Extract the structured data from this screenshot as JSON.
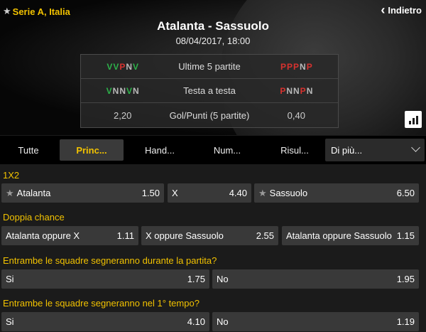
{
  "header": {
    "league": "Serie A, Italia",
    "back_label": "Indietro",
    "match_title": "Atalanta - Sassuolo",
    "match_date": "08/04/2017, 18:00"
  },
  "stats": {
    "last5": {
      "label": "Ultime 5 partite",
      "home": [
        "V",
        "V",
        "P",
        "N",
        "V"
      ],
      "away": [
        "P",
        "P",
        "P",
        "N",
        "P"
      ]
    },
    "h2h": {
      "label": "Testa a testa",
      "home": [
        "V",
        "N",
        "N",
        "V",
        "N"
      ],
      "away": [
        "P",
        "N",
        "N",
        "P",
        "N"
      ]
    },
    "goals": {
      "label": "Gol/Punti (5 partite)",
      "home": "2,20",
      "away": "0,40"
    }
  },
  "tabs": [
    {
      "label": "Tutte"
    },
    {
      "label": "Princ..."
    },
    {
      "label": "Hand..."
    },
    {
      "label": "Num..."
    },
    {
      "label": "Risul..."
    }
  ],
  "more_tab": "Di più...",
  "markets": {
    "m1x2": {
      "title": "1X2",
      "home_name": "Atalanta",
      "home_odd": "1.50",
      "draw_name": "X",
      "draw_odd": "4.40",
      "away_name": "Sassuolo",
      "away_odd": "6.50"
    },
    "double": {
      "title": "Doppia chance",
      "o1_name": "Atalanta oppure X",
      "o1_odd": "1.11",
      "o2_name": "X oppure Sassuolo",
      "o2_odd": "2.55",
      "o3_name": "Atalanta oppure Sassuolo",
      "o3_odd": "1.15"
    },
    "btts": {
      "title": "Entrambe le squadre segneranno durante la partita?",
      "yes_name": "Si",
      "yes_odd": "1.75",
      "no_name": "No",
      "no_odd": "1.95"
    },
    "btts_ht": {
      "title": "Entrambe le squadre segneranno nel 1° tempo?",
      "yes_name": "Si",
      "yes_odd": "4.10",
      "no_name": "No",
      "no_odd": "1.19"
    }
  },
  "colors": {
    "accent": "#f2c200",
    "win": "#2db24a",
    "loss": "#d8322f",
    "draw": "#b9b9b9"
  }
}
